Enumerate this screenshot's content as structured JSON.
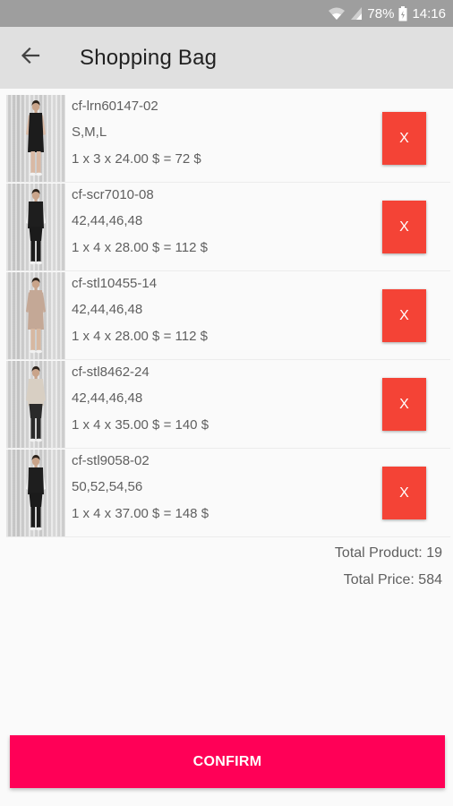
{
  "status_bar": {
    "battery_percent": "78%",
    "time": "14:16",
    "icons": [
      "wifi-icon",
      "signal-icon",
      "battery-icon"
    ]
  },
  "app_bar": {
    "back_icon": "arrow-left-icon",
    "title": "Shopping Bag"
  },
  "items": [
    {
      "code": "cf-lrn60147-02",
      "sizes": "S,M,L",
      "calc": "1 x 3 x 24.00 $ = 72 $",
      "remove_label": "X",
      "outfit": "dress-black"
    },
    {
      "code": "cf-scr7010-08",
      "sizes": "42,44,46,48",
      "calc": "1 x 4 x 28.00 $ = 112 $",
      "remove_label": "X",
      "outfit": "vest-white"
    },
    {
      "code": "cf-stl10455-14",
      "sizes": "42,44,46,48",
      "calc": "1 x 4 x 28.00 $ = 112 $",
      "remove_label": "X",
      "outfit": "dress-beige"
    },
    {
      "code": "cf-stl8462-24",
      "sizes": "42,44,46,48",
      "calc": "1 x 4 x 35.00 $ = 140 $",
      "remove_label": "X",
      "outfit": "cardigan-check"
    },
    {
      "code": "cf-stl9058-02",
      "sizes": "50,52,54,56",
      "calc": "1 x 4 x 37.00 $ = 148 $",
      "remove_label": "X",
      "outfit": "vest-white"
    }
  ],
  "totals": {
    "total_product": "Total Product: 19",
    "total_price": "Total Price: 584"
  },
  "confirm_label": "CONFIRM",
  "colors": {
    "accent": "#ff0057",
    "remove": "#f44336",
    "app_bar": "#e0e0e0",
    "status_bar": "#9e9e9e"
  }
}
